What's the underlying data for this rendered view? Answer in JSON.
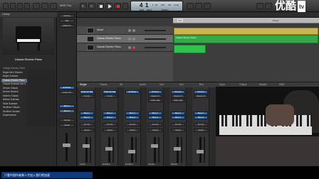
{
  "toolbar": {
    "lcd": {
      "bar": "4",
      "beat": "1",
      "division": "1",
      "tick": "54",
      "tempo": "120",
      "signature": "4/4",
      "key": "Cmaj",
      "labels": [
        "BAR",
        "BEAT",
        "TEMPO"
      ]
    },
    "title_fragment": "MIDI Tho",
    "logo": "优酷",
    "logo_badge": "tv"
  },
  "library": {
    "header": "Library",
    "patch_name": "Classic Electric Piano",
    "categories": [
      "Vintage Electric Piano",
      "Bright Mk II Electric",
      "Bright Suitcase",
      "Classic Electric Piano",
      "Classic Suitcase Mk IV",
      "Deluxe Classic",
      "Deluxe Modern",
      "Modern Classic",
      "Mellow Suitcase",
      "Wide Suitcase",
      "Wurlitzer Classic",
      "Wurlitzer Modern",
      "Experimental"
    ]
  },
  "strip": {
    "slots": [
      "Setting",
      "EQ",
      "MIDI FX",
      "E-Piano",
      "Audio FX",
      "Bus 1",
      "Bus 2",
      "Group",
      "Read"
    ]
  },
  "arrange": {
    "tracks": [
      {
        "name": "Vocal",
        "selected": false
      },
      {
        "name": "Classic Electric Piano",
        "selected": true
      },
      {
        "name": "Classic Electric Piano",
        "selected": false
      }
    ],
    "ruler_marker": "Intro",
    "ruler_label": "Bridge",
    "region_label": "Classic Electric Piano"
  },
  "mixer": {
    "tabs": [
      "Single",
      "Tracks",
      "All",
      "Audio",
      "Inst",
      "Aux",
      "Bus",
      "Input",
      "Output",
      "Master",
      "MIDI"
    ],
    "channels": [
      {
        "name": "Vocal",
        "plugins": [
          "Channel EQ",
          "Comp"
        ]
      },
      {
        "name": "E-Piano",
        "plugins": [
          "Channel EQ",
          "Comp"
        ]
      },
      {
        "name": "E-Piano",
        "plugins": [
          "E-Piano"
        ]
      },
      {
        "name": "Output",
        "plugins": [
          "Chorus",
          "Space D",
          "Chan EQ"
        ]
      },
      {
        "name": "Master",
        "plugins": [
          "Chorus",
          "Space D",
          "Chan EQ"
        ]
      },
      {
        "name": "",
        "plugins": [
          "Chorus",
          "Space D"
        ]
      }
    ],
    "sends": [
      "Bus 1",
      "Bus 2"
    ],
    "output": "St Out",
    "automation": "Read"
  },
  "caption": "只看中国作者果人才加入我们吧加速",
  "colors": {
    "region_green": "#37b24d",
    "region_yellow": "#d4c05a",
    "selection_blue": "#3b6ea8"
  }
}
